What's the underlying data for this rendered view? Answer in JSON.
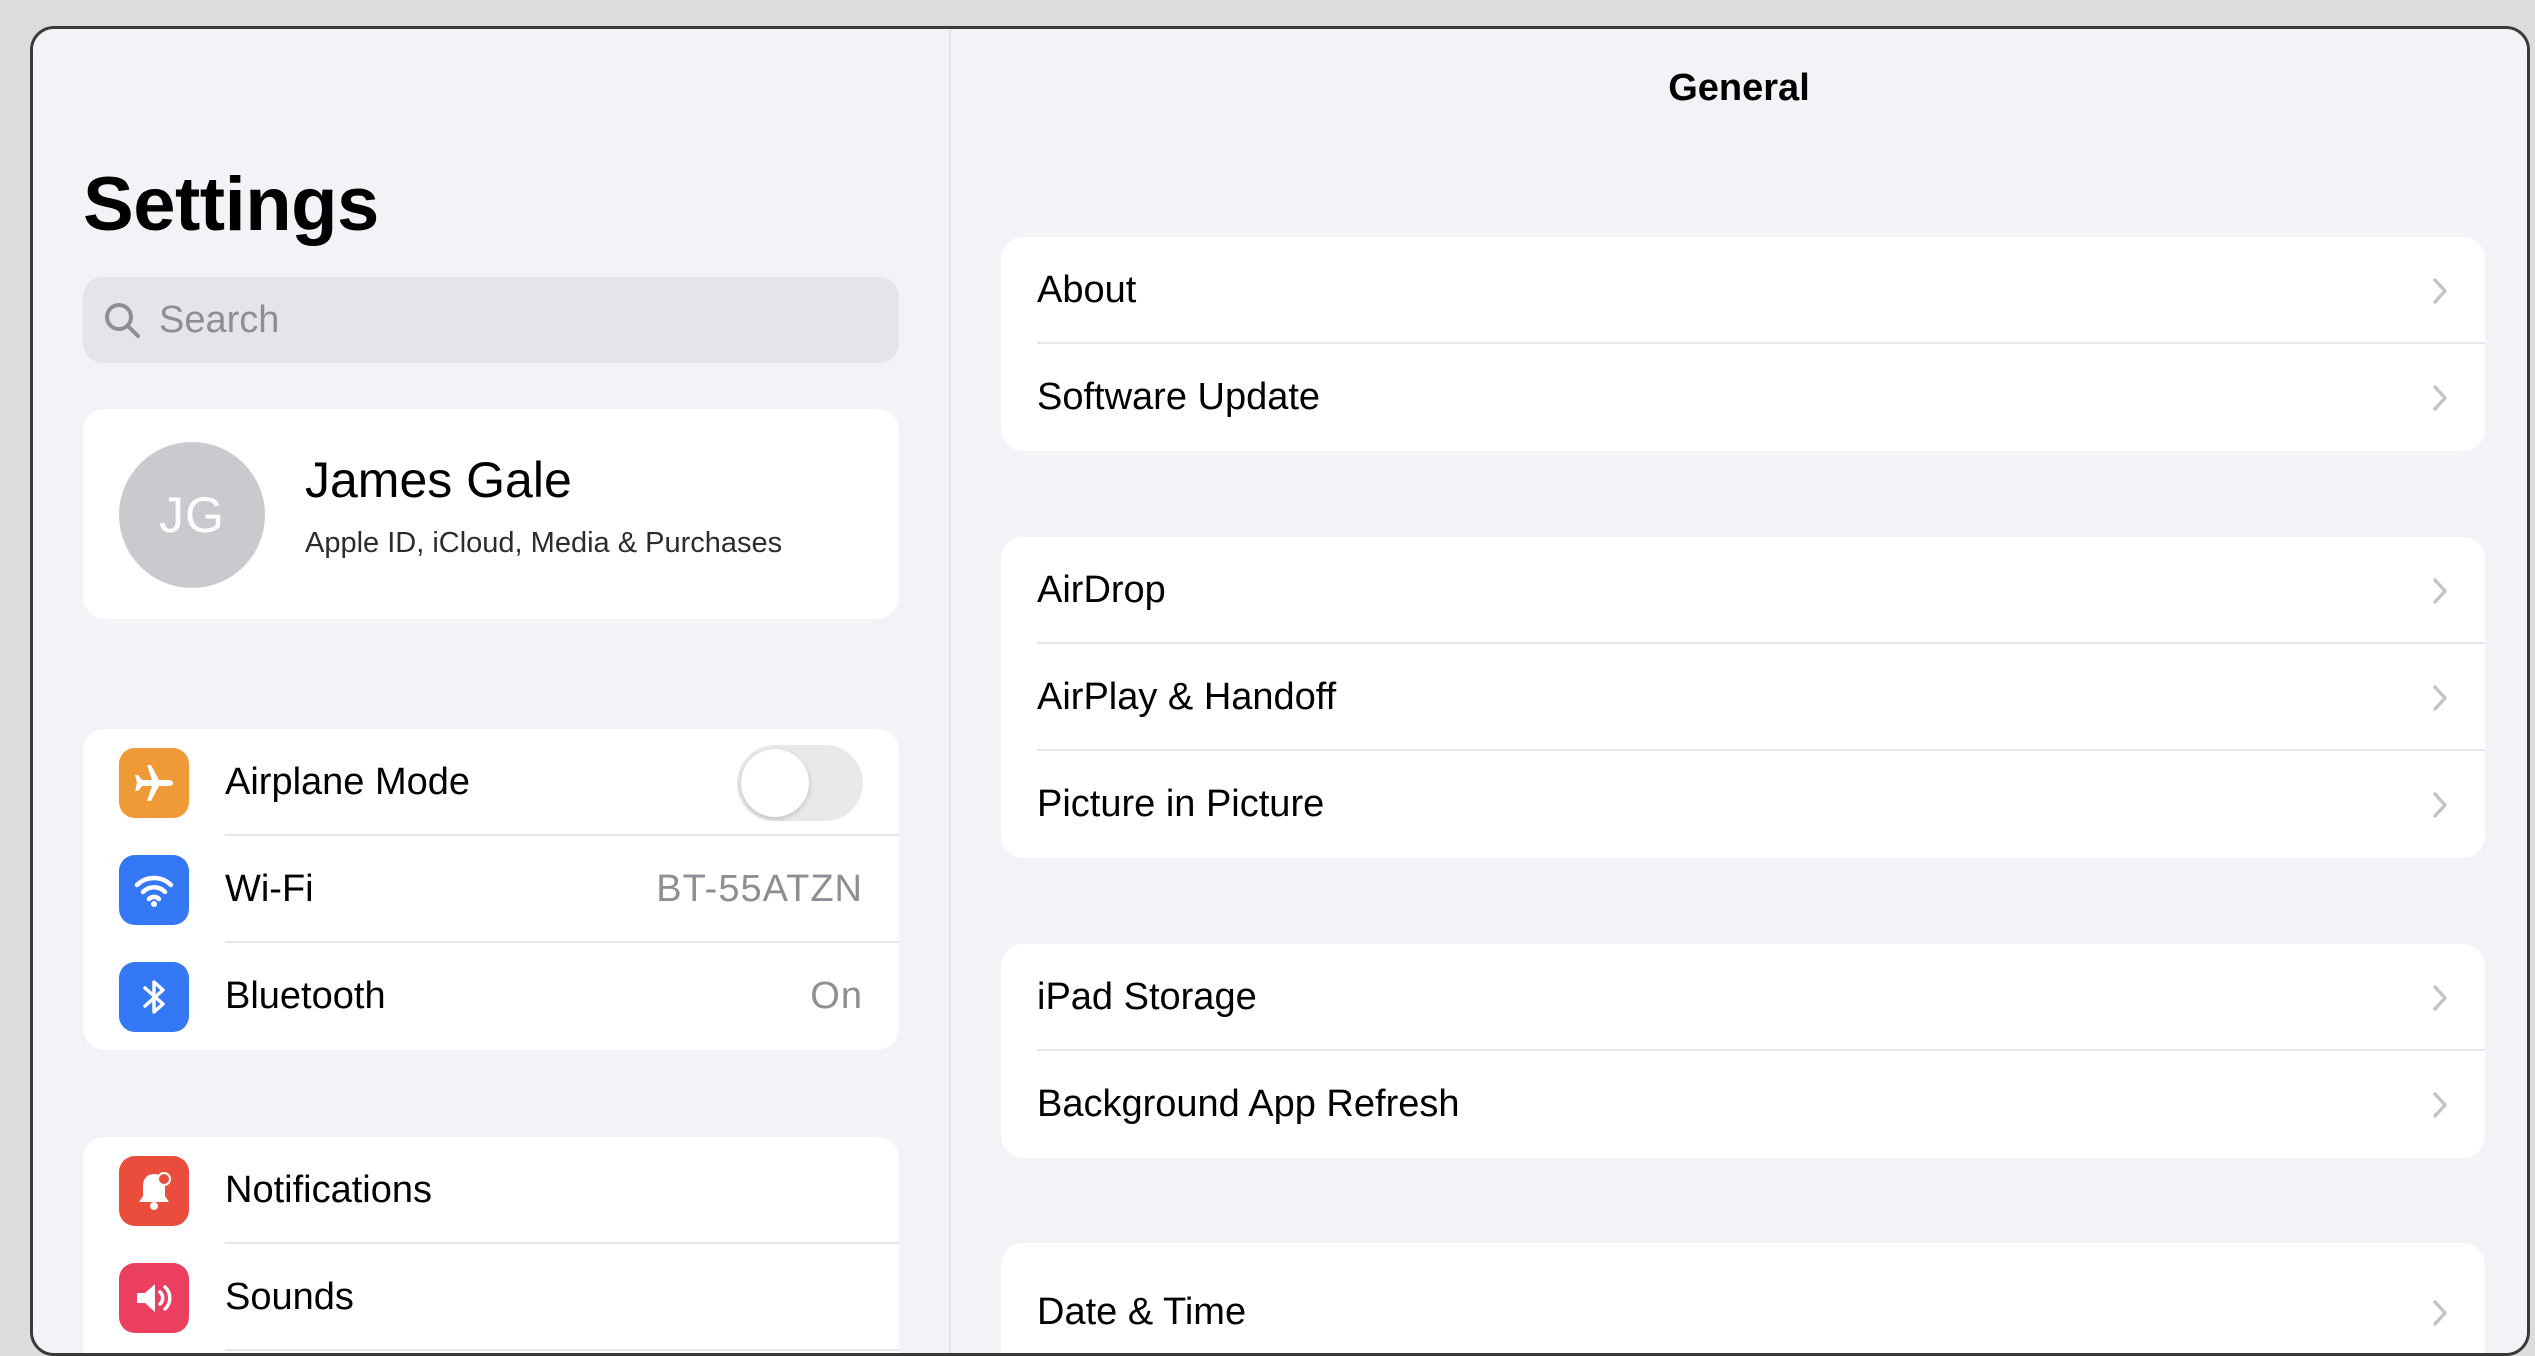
{
  "sidebar": {
    "title": "Settings",
    "search": {
      "placeholder": "Search",
      "icon": "search-icon"
    },
    "profile": {
      "initials": "JG",
      "name": "James Gale",
      "subtitle": "Apple ID, iCloud, Media & Purchases"
    },
    "network": [
      {
        "label": "Airplane Mode",
        "icon": "airplane-icon",
        "color": "#f09a37",
        "toggle_on": false
      },
      {
        "label": "Wi-Fi",
        "icon": "wifi-icon",
        "color": "#3478f6",
        "value": "BT-55ATZN"
      },
      {
        "label": "Bluetooth",
        "icon": "bluetooth-icon",
        "color": "#3478f6",
        "value": "On"
      }
    ],
    "alerts": [
      {
        "label": "Notifications",
        "icon": "bell-icon",
        "color": "#eb4d3d"
      },
      {
        "label": "Sounds",
        "icon": "speaker-icon",
        "color": "#ea3f5f"
      }
    ]
  },
  "detail": {
    "title": "General",
    "groups": [
      [
        "About",
        "Software Update"
      ],
      [
        "AirDrop",
        "AirPlay & Handoff",
        "Picture in Picture"
      ],
      [
        "iPad Storage",
        "Background App Refresh"
      ],
      [
        "Date & Time"
      ]
    ],
    "chevron_icon": "chevron-right-icon"
  }
}
